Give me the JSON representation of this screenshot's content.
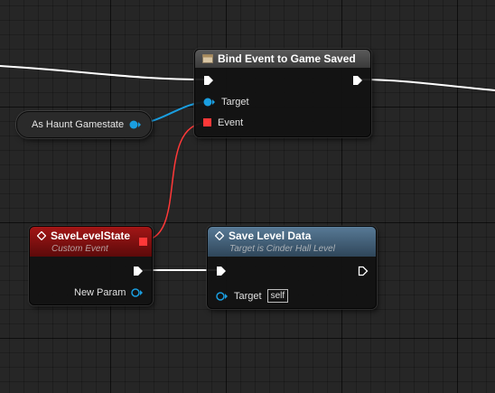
{
  "colors": {
    "exec_wire": "#ffffff",
    "object_pin": "#1a9ee0",
    "delegate_pin": "#ff3838",
    "event_header": "#8a1010",
    "function_header": "#3d5a73"
  },
  "nodes": {
    "bind_event": {
      "title": "Bind Event to Game Saved",
      "icon": "function-icon",
      "pins": {
        "target_label": "Target",
        "event_label": "Event"
      }
    },
    "variable": {
      "label": "As Haunt Gamestate"
    },
    "custom_event": {
      "title": "SaveLevelState",
      "subtitle": "Custom Event",
      "icon": "event-icon",
      "pins": {
        "param_label": "New Param"
      }
    },
    "save_level": {
      "title": "Save Level Data",
      "subtitle": "Target is Cinder Hall Level",
      "icon": "function-icon",
      "pins": {
        "target_label": "Target",
        "target_value": "self"
      }
    }
  }
}
